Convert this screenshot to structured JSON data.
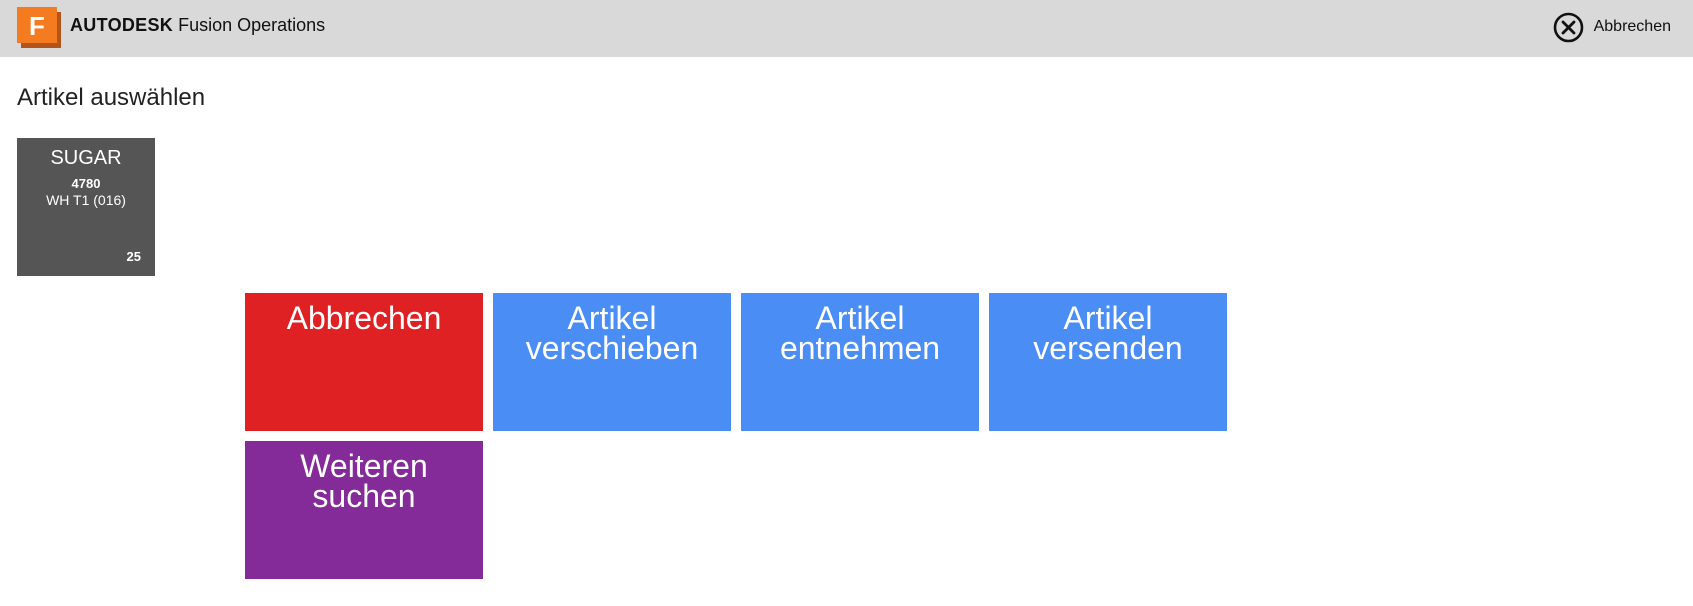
{
  "header": {
    "logo_letter": "F",
    "brand_bold": "AUTODESK",
    "brand_product": "Fusion Operations",
    "cancel_label": "Abbrechen",
    "cancel_icon": "close-circle-icon"
  },
  "page": {
    "title": "Artikel auswählen"
  },
  "item": {
    "name": "SUGAR",
    "number": "4780",
    "location": "WH T1 (016)",
    "quantity": "25"
  },
  "actions": [
    {
      "line1": "Abbrechen",
      "line2": "",
      "color": "#e02124"
    },
    {
      "line1": "Artikel",
      "line2": "verschieben",
      "color": "#4a8ef5"
    },
    {
      "line1": "Artikel",
      "line2": "entnehmen",
      "color": "#4a8ef5"
    },
    {
      "line1": "Artikel",
      "line2": "versenden",
      "color": "#4a8ef5"
    },
    {
      "line1": "Weiteren",
      "line2": "suchen",
      "color": "#842b99"
    }
  ],
  "colors": {
    "header_bg": "#d9d9d9",
    "logo_orange": "#f47b20",
    "tile_gray": "#555555"
  }
}
